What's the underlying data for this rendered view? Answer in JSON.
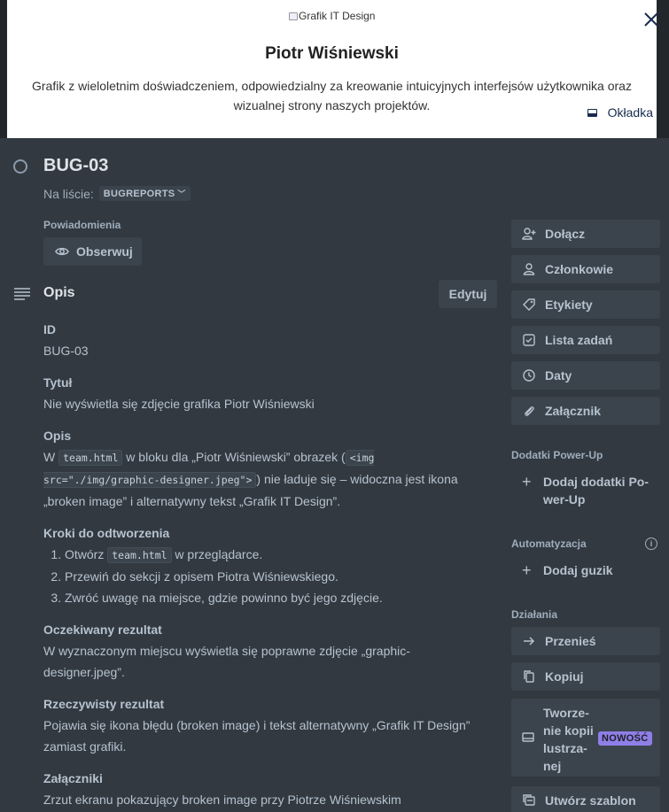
{
  "cover": {
    "image_alt": "Grafik IT Design",
    "person_name": "Piotr Wiśniewski",
    "person_description": "Grafik z wieloletnim doświadczeniem, odpowiedzialny za kreowanie intuicyjnych interfejsów użytkownika oraz wizualnej strony naszych projektów.",
    "cover_button": "Okładka"
  },
  "card": {
    "title": "BUG-03",
    "in_list_label": "Na liście:",
    "list_name": "BUGREPORTS",
    "notifications_label": "Powiadomienia",
    "watch_button": "Obserwuj"
  },
  "description": {
    "heading": "Opis",
    "edit_button": "Edytuj",
    "id_heading": "ID",
    "id_value": "BUG-03",
    "title_heading": "Tytuł",
    "title_value": "Nie wyświetla się zdjęcie grafika Piotr Wiśniewski",
    "desc_heading": "Opis",
    "desc_part1": "W ",
    "desc_code1": "team.html",
    "desc_part2": " w bloku dla „Piotr Wiśniewski” obrazek (",
    "desc_code2": "<img src=\"./img/graphic-designer.jpeg\">",
    "desc_part3": ") nie ładuje się – widoczna jest ikona „broken image” i alternatywny tekst „Grafik IT Design”.",
    "steps_heading": "Kroki do odtworzenia",
    "step1_a": "Otwórz ",
    "step1_code": "team.html",
    "step1_b": " w przeglądarce.",
    "step2": "Przewiń do sekcji z opisem Piotra Wiśniewskiego.",
    "step3": "Zwróć uwagę na miejsce, gdzie powinno być jego zdjęcie.",
    "expected_heading": "Oczekiwany rezultat",
    "expected_value": "W wyznaczonym miejscu wyświetla się poprawne zdjęcie „graphic-designer.jpeg”.",
    "actual_heading": "Rzeczywisty rezultat",
    "actual_value": "Pojawia się ikona błędu (broken image) i tekst alternatywny „Grafik IT Design” zamiast grafiki.",
    "attachments_heading": "Załączniki",
    "attachments_value": "Zrzut ekranu pokazujący broken image przy Piotrze Wiśniewskim"
  },
  "sidebar": {
    "join": "Dołącz",
    "members": "Członkowie",
    "labels": "Etykiety",
    "checklist": "Lista zadań",
    "dates": "Daty",
    "attachment": "Załącznik",
    "powerups_label": "Dodatki Power-Up",
    "add_powerups_line1": "Dodaj dodatki Po-",
    "add_powerups_line2": "wer-Up",
    "automation_label": "Automatyzacja",
    "add_button": "Dodaj guzik",
    "actions_label": "Działania",
    "move": "Przenieś",
    "copy": "Kopiuj",
    "mirror_line1": "Tworze-",
    "mirror_line2": "nie kopii",
    "mirror_line3": "lustrza-",
    "mirror_line4": "nej",
    "new_badge": "NOWOŚĆ",
    "create_template": "Utwórz szablon"
  },
  "colors": {
    "background": "#323940",
    "button": "#3b444c",
    "text": "#b6c2cf",
    "badge": "#8f7ee7"
  }
}
